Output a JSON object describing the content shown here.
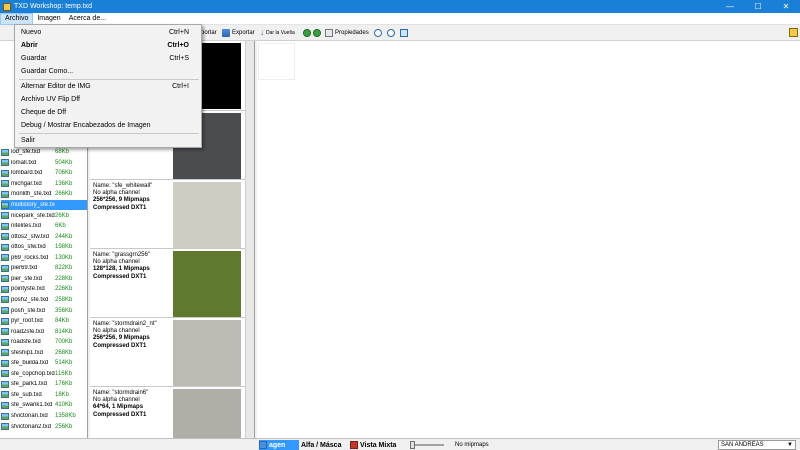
{
  "window": {
    "title": "TXD Workshop: temp.txd",
    "controls": [
      "—",
      "☐",
      "✕"
    ]
  },
  "menubar": [
    "Archivo",
    "Imagen",
    "Acerca de..."
  ],
  "toolbar": {
    "import_tail": "portar",
    "export": "Exportar",
    "rotate": "Dar la Vuelta",
    "properties": "Propiedades"
  },
  "archivo_menu": [
    {
      "label": "Nuevo",
      "shortcut": "Ctrl+N",
      "bold": false
    },
    {
      "label": "Abrir",
      "shortcut": "Ctrl+O",
      "bold": true
    },
    {
      "label": "Guardar",
      "shortcut": "Ctrl+S",
      "bold": false
    },
    {
      "label": "Guardar Como...",
      "shortcut": "",
      "bold": false
    },
    {
      "label": "Alternar Editor de IMG",
      "shortcut": "Ctrl+I",
      "bold": false
    },
    {
      "label": "Archivo UV Flip Dff",
      "shortcut": "",
      "bold": false
    },
    {
      "label": "Cheque de Dff",
      "shortcut": "",
      "bold": false
    },
    {
      "label": "Debug / Mostrar Encabezados de Imagen",
      "shortcut": "",
      "bold": false
    },
    {
      "label": "Salir",
      "shortcut": "",
      "bold": false
    }
  ],
  "files": [
    {
      "name": "lod_sfe.txd",
      "size": "68Kb"
    },
    {
      "name": "lomall.txd",
      "size": "504Kb"
    },
    {
      "name": "lombard.txd",
      "size": "706Kb"
    },
    {
      "name": "michgar.txd",
      "size": "136Kb"
    },
    {
      "name": "monlith_sfe.txd",
      "size": "266Kb"
    },
    {
      "name": "multistory_sfe.txd",
      "size": "",
      "selected": true
    },
    {
      "name": "nicepark_sfe.txd",
      "size": "26Kb"
    },
    {
      "name": "nitelites.txd",
      "size": "6Kb"
    },
    {
      "name": "ottos2_sfw.txd",
      "size": "244Kb"
    },
    {
      "name": "ottos_sfw.txd",
      "size": "198Kb"
    },
    {
      "name": "p69_rocks.txd",
      "size": "130Kb"
    },
    {
      "name": "pier69.txd",
      "size": "822Kb"
    },
    {
      "name": "pier_sfe.txd",
      "size": "228Kb"
    },
    {
      "name": "pointysfe.txd",
      "size": "226Kb"
    },
    {
      "name": "posh2_sfe.txd",
      "size": "258Kb"
    },
    {
      "name": "posh_sfe.txd",
      "size": "356Kb"
    },
    {
      "name": "pyr_roof.txd",
      "size": "84Kb"
    },
    {
      "name": "road2sfe.txd",
      "size": "814Kb"
    },
    {
      "name": "roadsfe.txd",
      "size": "700Kb"
    },
    {
      "name": "sfeship1.txd",
      "size": "268Kb"
    },
    {
      "name": "sfe_builda.txd",
      "size": "514Kb"
    },
    {
      "name": "sfe_copchop.txd",
      "size": "116Kb"
    },
    {
      "name": "sfe_park1.txd",
      "size": "176Kb"
    },
    {
      "name": "sfe_sub.txd",
      "size": "18Kb"
    },
    {
      "name": "sfe_swank1.txd",
      "size": "410Kb"
    },
    {
      "name": "sfvictorian.txd",
      "size": "1358Kb"
    },
    {
      "name": "sfvictorian2.txd",
      "size": "256Kb"
    }
  ],
  "textures": [
    {
      "name": "Name: \"sfe_whitewall\"",
      "alpha": "No alpha channel",
      "dims": "256*256, 9 Mipmaps",
      "comp": "Compressed DXT1",
      "tex": "#cfccc4"
    },
    {
      "name": "Name: \"grassgrn256\"",
      "alpha": "No alpha channel",
      "dims": "128*128, 1 Mipmaps",
      "comp": "Compressed DXT1",
      "tex": "#5f7a2e"
    },
    {
      "name": "Name: \"stormdrain2_nt\"",
      "alpha": "No alpha channel",
      "dims": "256*256, 9 Mipmaps",
      "comp": "Compressed DXT1",
      "tex": "#bdbbb3"
    },
    {
      "name": "Name: \"stormdrain6\"",
      "alpha": "No alpha channel",
      "dims": "64*64, 1 Mipmaps",
      "comp": "Compressed DXT1",
      "tex": "#b0aea6"
    }
  ],
  "bottombar": {
    "tab_image_tail": "agen",
    "tab_alpha": "Alfa / Másca",
    "tab_mixed": "Vista Mixta",
    "mipmaps": "No mipmaps",
    "game": "SAN ANDREAS"
  }
}
